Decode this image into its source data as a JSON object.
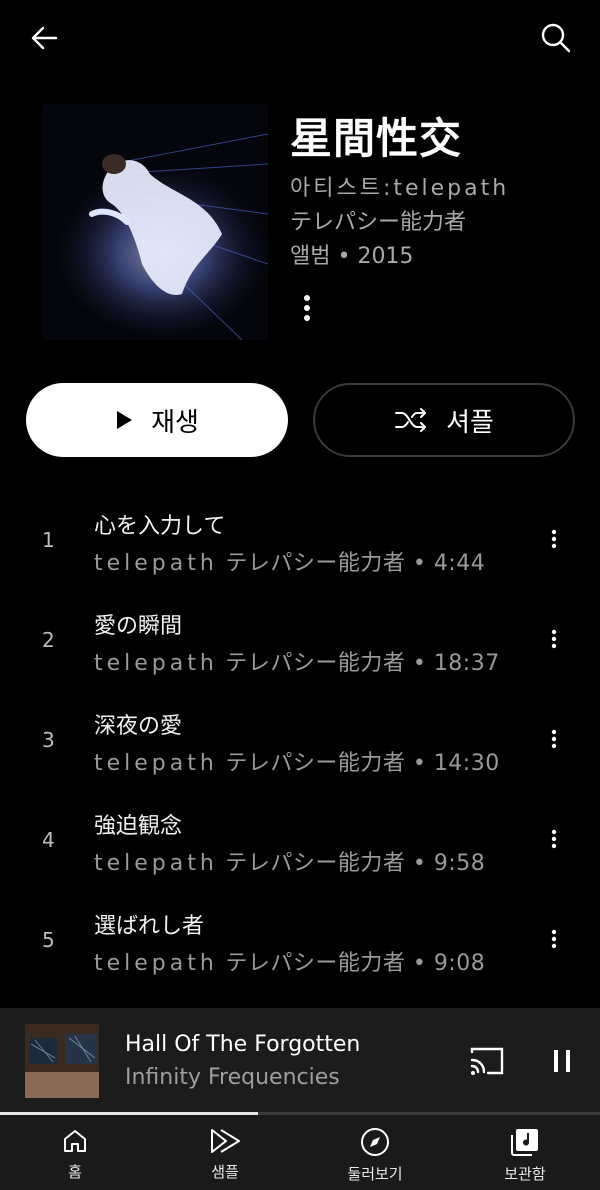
{
  "topbar": {
    "back_icon": "arrow-left-icon",
    "search_icon": "search-icon"
  },
  "album": {
    "title": "星間性交",
    "artist_line": "아티스트:telepath",
    "artist_line2": "テレパシー能力者",
    "type_year": "앨범 • 2015"
  },
  "actions": {
    "play_label": "재생",
    "shuffle_label": "셔플"
  },
  "tracks": [
    {
      "num": "1",
      "title": "心を入力して",
      "artist": "telepath",
      "artist2": "テレパシー能力者",
      "duration": "• 4:44"
    },
    {
      "num": "2",
      "title": "愛の瞬間",
      "artist": "telepath",
      "artist2": "テレパシー能力者",
      "duration": "• 18:37"
    },
    {
      "num": "3",
      "title": "深夜の愛",
      "artist": "telepath",
      "artist2": "テレパシー能力者",
      "duration": "• 14:30"
    },
    {
      "num": "4",
      "title": "強迫観念",
      "artist": "telepath",
      "artist2": "テレパシー能力者",
      "duration": "• 9:58"
    },
    {
      "num": "5",
      "title": "選ばれし者",
      "artist": "telepath",
      "artist2": "テレパシー能力者",
      "duration": "• 9:08"
    }
  ],
  "mini_player": {
    "title": "Hall Of The Forgotten",
    "artist": "Infinity Frequencies",
    "progress": 0.43
  },
  "nav": {
    "items": [
      {
        "label": "홈",
        "icon": "home-icon"
      },
      {
        "label": "샘플",
        "icon": "samples-icon"
      },
      {
        "label": "둘러보기",
        "icon": "explore-compass-icon"
      },
      {
        "label": "보관함",
        "icon": "library-icon"
      }
    ]
  },
  "colors": {
    "background": "#000000",
    "secondary_text": "#a9a9a9",
    "mini_bg": "#1c1c1c"
  }
}
